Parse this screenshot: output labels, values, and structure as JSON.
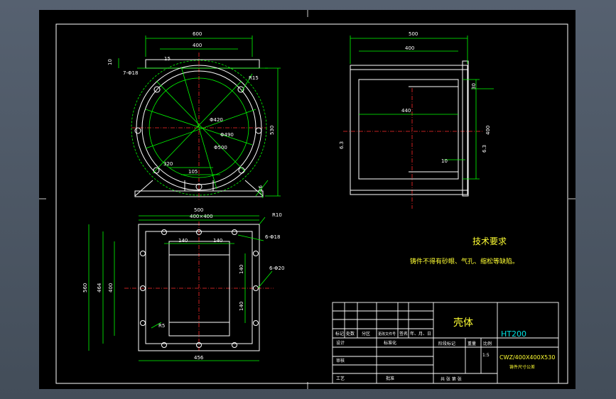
{
  "dimensions": {
    "front_width_outer": "600",
    "front_width_inner": "400",
    "front_flange_thk": "10",
    "front_holes": "7-Φ18",
    "front_angle": "15",
    "front_dia_a": "Φ420",
    "front_dia_b": "Φ490",
    "front_dia_c": "Φ500",
    "front_height": "530",
    "front_base_w": "320",
    "front_base_h": "105",
    "front_base_thk": "16",
    "front_r": "R15",
    "side_width_outer": "500",
    "side_width_inner": "400",
    "side_inner": "440",
    "side_dim_a": "30",
    "side_dim_b": "10",
    "side_h": "400",
    "side_rough_left": "6.3",
    "side_rough_right": "6.3",
    "plan_width": "500",
    "plan_width_b": "400×400",
    "plan_r": "R10",
    "plan_holes_a": "6-Φ18",
    "plan_holes_b": "6-Φ20",
    "plan_a": "140",
    "plan_b": "140",
    "plan_c": "140",
    "plan_d": "140",
    "plan_h_outer": "560",
    "plan_h_mid": "464",
    "plan_h_in": "400",
    "plan_bottom": "456",
    "plan_r2": "R5"
  },
  "notes": {
    "title": "技术要求",
    "text": "铸件不得有砂眼、气孔、缩松等缺陷。"
  },
  "title_block": {
    "part_name": "壳体",
    "material": "HT200",
    "drawing_no": "CWZ/400X400X530",
    "sub_title": "铸件尺寸公差",
    "scale": "1:5",
    "headers": [
      "标记",
      "处数",
      "分区",
      "更改文件号",
      "签名",
      "年、月、日"
    ],
    "rows_left": [
      "设计",
      "审核",
      "工艺"
    ],
    "std": "标准化",
    "approve": "批准",
    "stage_label": "阶段标记",
    "weight_label": "重量",
    "ratio_label": "比例",
    "sheet_info": "共  张  第  张"
  },
  "colors": {
    "sheet": "#000000",
    "outline": "#ffffff",
    "geometry": "#00ff00",
    "centerline": "#ff2a2a",
    "note": "#ffff33",
    "title": "#ffff33"
  }
}
